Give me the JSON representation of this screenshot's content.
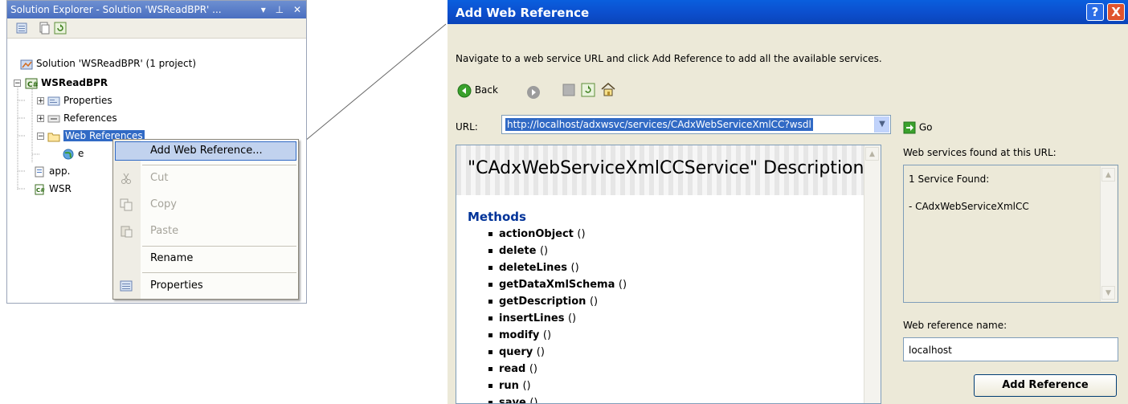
{
  "solution_explorer": {
    "title": "Solution Explorer - Solution 'WSReadBPR' ...",
    "title_controls": [
      "▾",
      "⊥",
      "✕"
    ],
    "tree": {
      "solution": "Solution 'WSReadBPR' (1 project)",
      "project": "WSReadBPR",
      "properties": "Properties",
      "references": "References",
      "web_references": "Web References",
      "web_ref_child": "e",
      "app": "app.",
      "wsr": "WSR"
    }
  },
  "context_menu": {
    "items": [
      {
        "label": "Add Web Reference...",
        "icon": "none",
        "state": "selected"
      },
      {
        "label": "Cut",
        "icon": "scissors-icon",
        "state": "disabled"
      },
      {
        "label": "Copy",
        "icon": "copy-icon",
        "state": "disabled"
      },
      {
        "label": "Paste",
        "icon": "paste-icon",
        "state": "disabled"
      },
      {
        "label": "Rename",
        "icon": "none",
        "state": "enabled"
      },
      {
        "label": "Properties",
        "icon": "properties-icon",
        "state": "enabled"
      }
    ]
  },
  "dialog": {
    "title": "Add Web Reference",
    "help_button": "?",
    "close_button": "X",
    "instruction": "Navigate to a web service URL and click Add Reference to add all the available services.",
    "back_label": "Back",
    "url_label": "URL:",
    "url_value": "http://localhost/adxwsvc/services/CAdxWebServiceXmlCC?wsdl",
    "go_label": "Go",
    "service_title": "\"CAdxWebServiceXmlCCService\" Description",
    "methods_heading": "Methods",
    "methods": [
      "actionObject",
      "delete",
      "deleteLines",
      "getDataXmlSchema",
      "getDescription",
      "insertLines",
      "modify",
      "query",
      "read",
      "run",
      "save"
    ],
    "method_parens": "()",
    "found_label": "Web services found at this URL:",
    "found_count": "1 Service Found:",
    "found_service": "- CAdxWebServiceXmlCC",
    "ref_name_label": "Web reference name:",
    "ref_name_value": "localhost",
    "add_reference_label": "Add Reference"
  },
  "colors": {
    "xp_title_blue": "#0c4dcb",
    "vs_title_blue": "#5a7fc8",
    "selection_blue": "#316ac5",
    "dialog_face": "#ece9d8",
    "methods_blue": "#003399"
  }
}
